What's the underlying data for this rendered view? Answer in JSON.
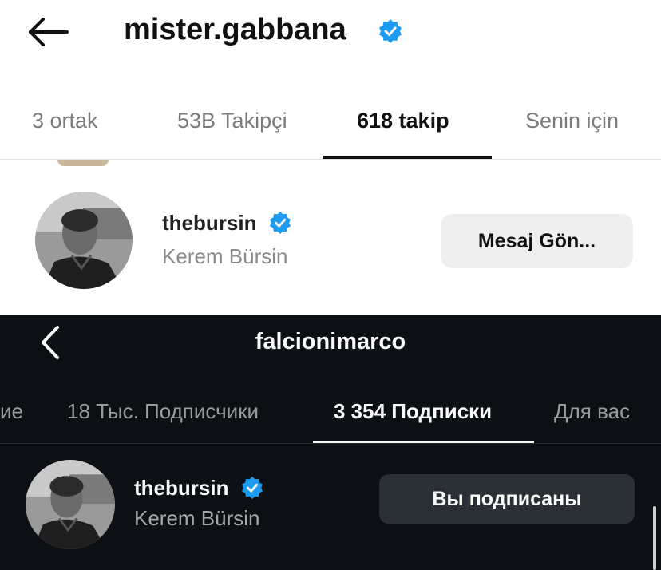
{
  "top": {
    "title": "mister.gabbana",
    "tabs": [
      {
        "label": "3 ortak"
      },
      {
        "label": "53B Takipçi"
      },
      {
        "label": "618 takip"
      },
      {
        "label": "Senin için"
      }
    ],
    "user": {
      "username": "thebursin",
      "full_name": "Kerem Bürsin",
      "button_label": "Mesaj Gön..."
    }
  },
  "bottom": {
    "title": "falcionimarco",
    "tabs": [
      {
        "label": "ие"
      },
      {
        "label": "18 Тыс. Подписчики"
      },
      {
        "label": "3 354 Подписки"
      },
      {
        "label": "Для вас"
      }
    ],
    "user": {
      "username": "thebursin",
      "full_name": "Kerem Bürsin",
      "button_label": "Вы подписаны"
    }
  },
  "icons": {
    "back_top": "arrow-left-icon",
    "back_bottom": "chevron-left-icon",
    "verified": "verified-badge-icon"
  },
  "colors": {
    "verified_blue": "#1d9bf0",
    "light_bg": "#ffffff",
    "dark_bg": "#0c1014",
    "active_tab_indicator_light": "#111111",
    "active_tab_indicator_dark": "#f5f5f5"
  }
}
